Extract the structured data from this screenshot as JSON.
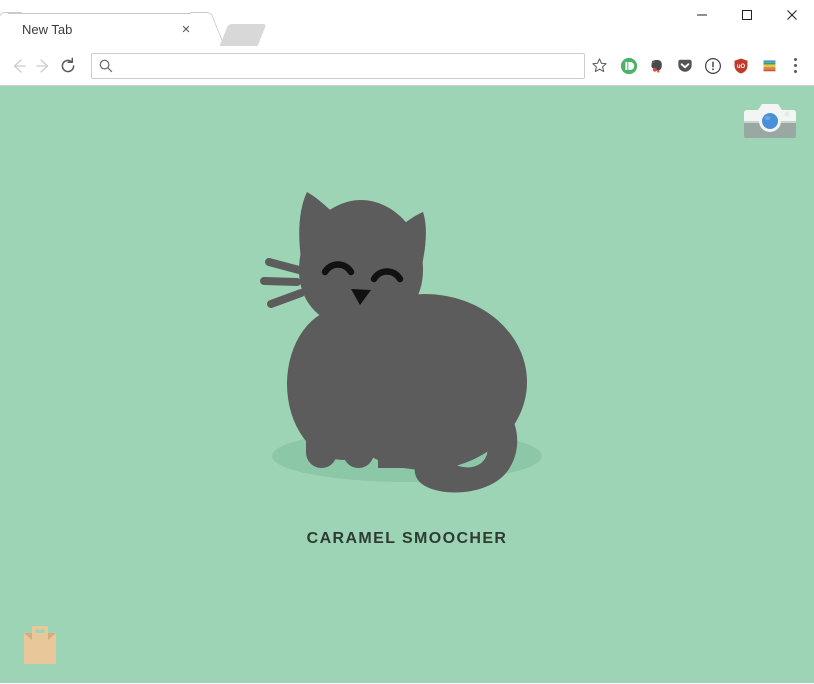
{
  "window": {
    "controls": [
      {
        "name": "minimize-button",
        "glyph": "minimize"
      },
      {
        "name": "maximize-button",
        "glyph": "maximize"
      },
      {
        "name": "close-button",
        "glyph": "close"
      }
    ]
  },
  "tabs": [
    {
      "title": "New Tab",
      "close_label": "×",
      "active": true
    }
  ],
  "toolbar": {
    "back_label": "Back",
    "forward_label": "Forward",
    "reload_label": "Reload",
    "bookmark_label": "Bookmark this page",
    "menu_label": "Customize and control Google Chrome",
    "omnibox": {
      "value": "",
      "placeholder": "",
      "search_icon": "search-icon"
    },
    "extensions": [
      {
        "name": "pushbullet-extension-icon",
        "label": "Pushbullet",
        "color": "#4AB367"
      },
      {
        "name": "evernote-extension-icon",
        "label": "Evernote Web Clipper",
        "color": "#4a4a4a"
      },
      {
        "name": "pocket-extension-icon",
        "label": "Save to Pocket",
        "color": "#555555"
      },
      {
        "name": "privacy-badger-extension-icon",
        "label": "Privacy Badger",
        "color": "#3d3d3d"
      },
      {
        "name": "ublock-origin-extension-icon",
        "label": "uBlock Origin",
        "color": "#c0392b"
      },
      {
        "name": "colorzilla-extension-icon",
        "label": "Color Stripes",
        "color": "#4a90d9"
      }
    ]
  },
  "page": {
    "background_color": "#9dd4b5",
    "cat_color": "#5c5c5c",
    "caption": "CARAMEL SMOOCHER",
    "caption_color": "#2e3b33",
    "camera_badge": {
      "name": "camera-icon",
      "body_color": "#f0f4f2",
      "base_color": "#9aa8a3",
      "lens_color": "#4a90d9"
    },
    "bag_badge": {
      "name": "shopping-bag-icon",
      "color": "#e8c89a",
      "shade_color": "#d4ae7a"
    }
  }
}
